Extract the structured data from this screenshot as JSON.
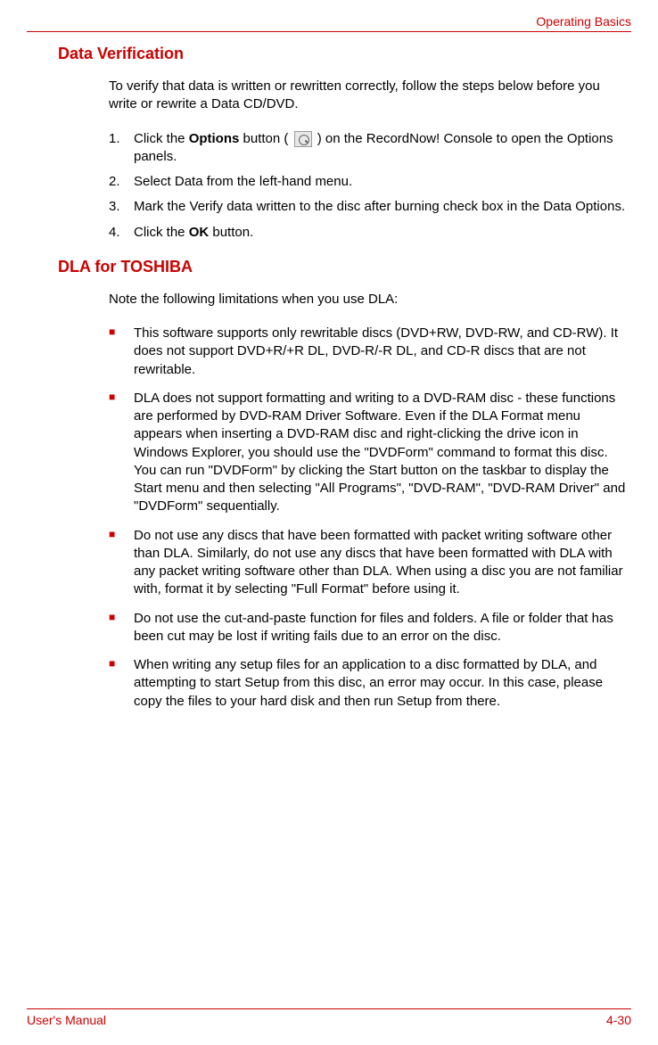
{
  "header": {
    "section_title": "Operating Basics"
  },
  "section1": {
    "heading": "Data Verification",
    "intro": "To verify that data is written or rewritten correctly, follow the steps below before you write or rewrite a Data CD/DVD.",
    "steps": {
      "s1_pre": "Click the ",
      "s1_bold": "Options",
      "s1_mid": " button ( ",
      "s1_post": " ) on the RecordNow! Console to open the Options panels.",
      "s2": "Select Data from the left-hand menu.",
      "s3": "Mark the Verify data written to the disc after burning check box in the Data Options.",
      "s4_pre": "Click the ",
      "s4_bold": "OK",
      "s4_post": " button."
    }
  },
  "section2": {
    "heading": "DLA for TOSHIBA",
    "intro": "Note the following limitations when you use DLA:",
    "bullets": {
      "b1": "This software supports only rewritable discs (DVD+RW, DVD-RW, and CD-RW). It does not support DVD+R/+R DL, DVD-R/-R DL, and CD-R discs that are not rewritable.",
      "b2": "DLA does not support formatting and writing to a DVD-RAM disc - these functions are performed by DVD-RAM Driver Software. Even if the DLA Format menu appears when inserting a DVD-RAM disc and right-clicking the drive icon in Windows Explorer, you should use the \"DVDForm\" command to format this disc. You can run \"DVDForm\" by clicking the Start button on the taskbar to display the Start menu and then selecting \"All Programs\", \"DVD-RAM\", \"DVD-RAM Driver\" and \"DVDForm\" sequentially.",
      "b3": "Do not use any discs that have been formatted with packet writing software other than DLA. Similarly, do not use any discs that have been formatted with DLA with any packet writing software other than DLA. When using a disc you are not familiar with, format it by selecting \"Full Format\" before using it.",
      "b4": "Do not use the cut-and-paste function for files and folders. A file or folder that has been cut may be lost if writing fails due to an error on the disc.",
      "b5": "When writing any setup files for an application to a disc formatted by DLA, and attempting to start Setup from this disc, an error may occur. In this case, please copy the files to your hard disk and then run Setup from there."
    }
  },
  "footer": {
    "left": "User's Manual",
    "right": "4-30"
  }
}
